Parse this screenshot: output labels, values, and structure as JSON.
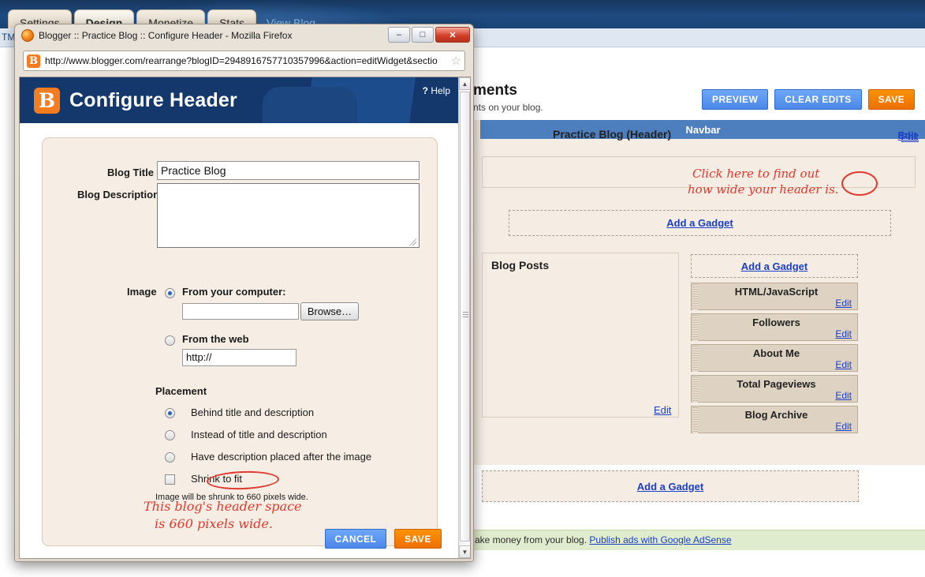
{
  "background": {
    "tabs": [
      {
        "label": "Settings",
        "active": false
      },
      {
        "label": "Design",
        "active": true
      },
      {
        "label": "Monetize",
        "active": false
      },
      {
        "label": "Stats",
        "active": false
      }
    ],
    "view_blog_label": "View Blog",
    "subnav_partial": "TML",
    "page_title_partial": "ments",
    "page_subtitle_partial": "nts on your blog.",
    "buttons": {
      "preview": "PREVIEW",
      "clear_edits": "CLEAR EDITS",
      "save": "SAVE"
    },
    "layout": {
      "navbar_label": "Navbar",
      "navbar_edit": "Edit",
      "header_label": "Practice Blog (Header)",
      "header_edit": "Edit",
      "add_gadget_top": "Add a Gadget",
      "blog_posts_label": "Blog Posts",
      "blog_posts_edit": "Edit",
      "add_gadget_sidebar": "Add a Gadget",
      "add_gadget_bottom": "Add a Gadget",
      "gadgets": [
        {
          "name": "HTML/JavaScript",
          "edit": "Edit"
        },
        {
          "name": "Followers",
          "edit": "Edit"
        },
        {
          "name": "About Me",
          "edit": "Edit"
        },
        {
          "name": "Total Pageviews",
          "edit": "Edit"
        },
        {
          "name": "Blog Archive",
          "edit": "Edit"
        }
      ]
    },
    "adsense_text": "ake money from your blog. ",
    "adsense_link": "Publish ads with Google AdSense"
  },
  "annotations": {
    "edit_line1": "Click here to find out",
    "edit_line2": "how wide your header is.",
    "dialog_line1": "This blog's header space",
    "dialog_line2": "is 660 pixels wide.",
    "color": "#e03a2f"
  },
  "firefox": {
    "window_title": "Blogger :: Practice Blog :: Configure Header - Mozilla Firefox",
    "url": "http://www.blogger.com/rearrange?blogID=2948916757710357996&action=editWidget&sectio",
    "site_icon_letter": "B",
    "star_glyph": "☆",
    "minimize_glyph": "–",
    "maximize_glyph": "□",
    "close_glyph": "✕"
  },
  "dialog": {
    "logo_letter": "B",
    "title": "Configure Header",
    "help_mark": "?",
    "help_label": "Help",
    "fields": {
      "blog_title_label": "Blog Title",
      "blog_title_value": "Practice Blog",
      "blog_description_label": "Blog Description",
      "blog_description_value": "",
      "image_label": "Image",
      "from_computer_label": "From your computer:",
      "file_value": "",
      "browse_label": "Browse…",
      "from_web_label": "From the web",
      "web_url_value": "http://"
    },
    "placement": {
      "heading": "Placement",
      "options": [
        {
          "label": "Behind title and description",
          "selected": true
        },
        {
          "label": "Instead of title and description",
          "selected": false
        },
        {
          "label": "Have description placed after the image",
          "selected": false
        }
      ],
      "shrink_to_fit_label": "Shrink to fit",
      "shrink_to_fit_checked": false,
      "shrink_note": "Image will be shrunk to 660 pixels wide."
    },
    "buttons": {
      "cancel": "CANCEL",
      "save": "SAVE"
    },
    "scrollbar": {
      "up_glyph": "▲",
      "down_glyph": "▼"
    }
  }
}
